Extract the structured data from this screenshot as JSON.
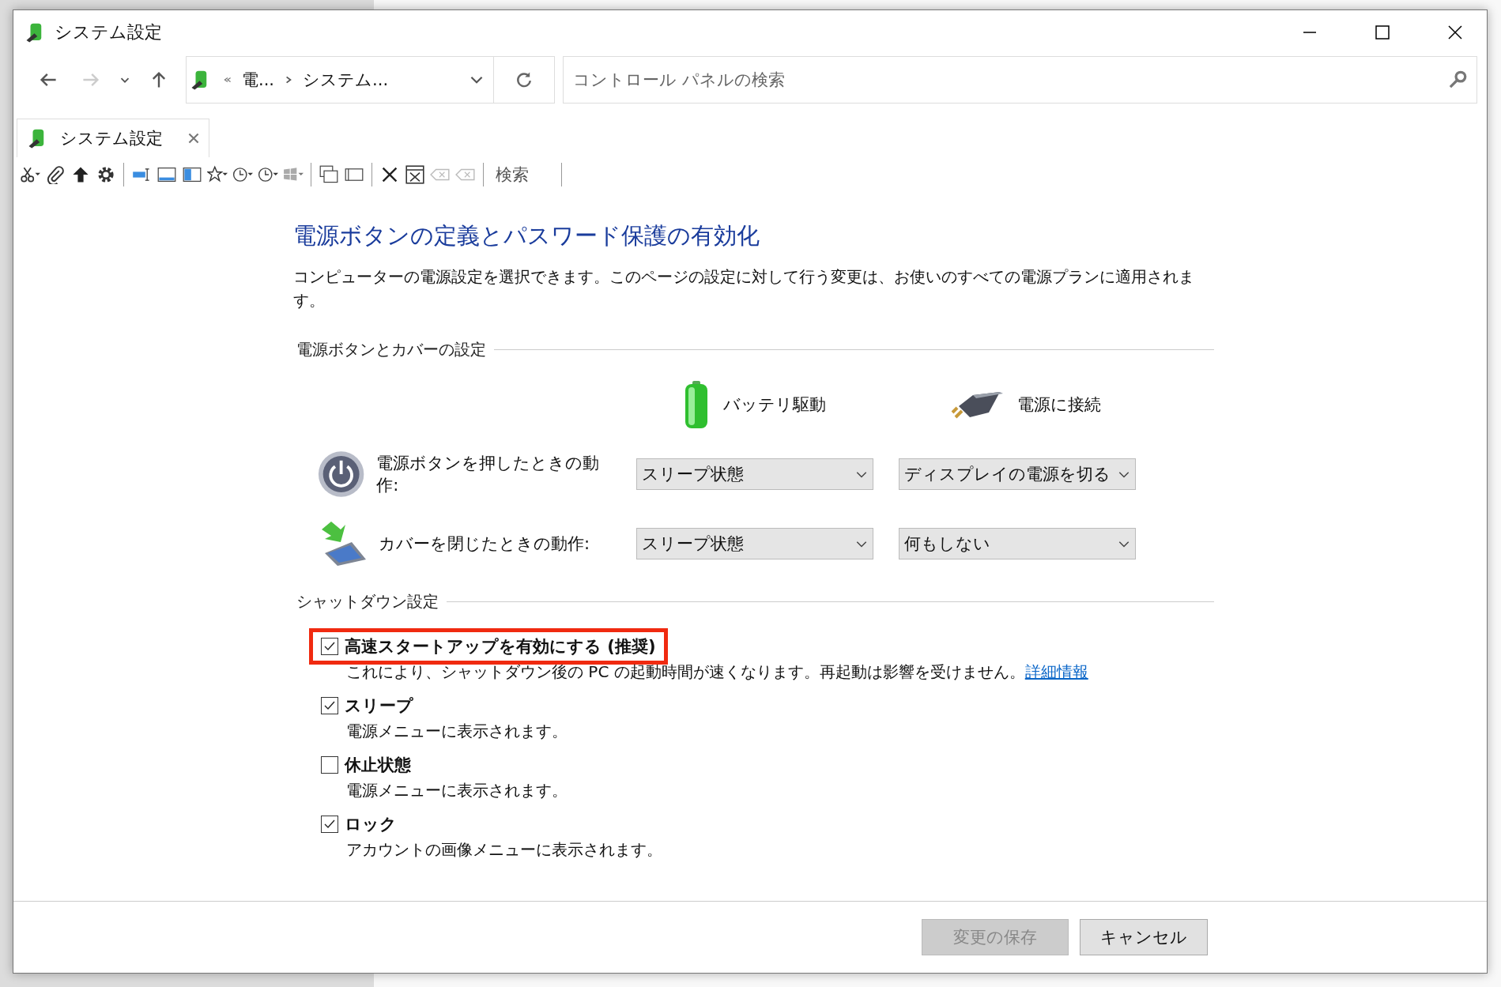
{
  "window": {
    "title": "システム設定"
  },
  "address": {
    "crumbs": [
      "電...",
      "システム..."
    ]
  },
  "search": {
    "placeholder": "コントロール パネルの検索"
  },
  "tab": {
    "label": "システム設定"
  },
  "toolbar": {
    "search_label": "検索"
  },
  "heading": "電源ボタンの定義とパスワード保護の有効化",
  "intro": "コンピューターの電源設定を選択できます。このページの設定に対して行う変更は、お使いのすべての電源プランに適用されます。",
  "power_section": {
    "title": "電源ボタンとカバーの設定",
    "columns": [
      {
        "kind": "battery",
        "label": "バッテリ駆動"
      },
      {
        "kind": "plug",
        "label": "電源に接続"
      }
    ],
    "rows": [
      {
        "kind": "power",
        "label": "電源ボタンを押したときの動作:",
        "values": [
          "スリープ状態",
          "ディスプレイの電源を切る"
        ]
      },
      {
        "kind": "lid",
        "label": "カバーを閉じたときの動作:",
        "values": [
          "スリープ状態",
          "何もしない"
        ]
      }
    ]
  },
  "shutdown_section": {
    "title": "シャットダウン設定",
    "options": [
      {
        "label": "高速スタートアップを有効にする (推奨)",
        "checked": true,
        "highlighted": true,
        "description": "これにより、シャットダウン後の PC の起動時間が速くなります。再起動は影響を受けません。",
        "link": "詳細情報"
      },
      {
        "label": "スリープ",
        "checked": true,
        "highlighted": false,
        "description": "電源メニューに表示されます。"
      },
      {
        "label": "休止状態",
        "checked": false,
        "highlighted": false,
        "description": "電源メニューに表示されます。"
      },
      {
        "label": "ロック",
        "checked": true,
        "highlighted": false,
        "description": "アカウントの画像メニューに表示されます。"
      }
    ]
  },
  "buttons": [
    {
      "label": "変更の保存",
      "disabled": true
    },
    {
      "label": "キャンセル",
      "disabled": false
    }
  ]
}
